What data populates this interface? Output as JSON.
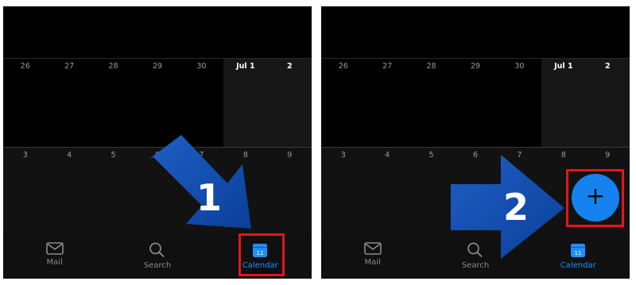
{
  "panels": [
    {
      "week1": [
        "26",
        "27",
        "28",
        "29",
        "30",
        "Jul 1",
        "2"
      ],
      "week2": [
        "3",
        "4",
        "5",
        "6",
        "7",
        "8",
        "9"
      ],
      "tabs": [
        {
          "label": "Mail",
          "icon": "mail-icon"
        },
        {
          "label": "Search",
          "icon": "search-icon"
        },
        {
          "label": "Calendar",
          "icon": "calendar-icon",
          "date": "11",
          "active": true
        }
      ],
      "step_number": "1"
    },
    {
      "week1": [
        "26",
        "27",
        "28",
        "29",
        "30",
        "Jul 1",
        "2"
      ],
      "week2": [
        "3",
        "4",
        "5",
        "6",
        "7",
        "8",
        "9"
      ],
      "tabs": [
        {
          "label": "Mail",
          "icon": "mail-icon"
        },
        {
          "label": "Search",
          "icon": "search-icon"
        },
        {
          "label": "Calendar",
          "icon": "calendar-icon",
          "date": "11",
          "active": true
        }
      ],
      "step_number": "2",
      "fab": {
        "symbol": "+",
        "icon": "plus-icon"
      }
    }
  ],
  "colors": {
    "accent": "#1e90ff",
    "fab": "#1582f0",
    "highlight": "#e3161b",
    "arrow": "#0d4fb3"
  }
}
